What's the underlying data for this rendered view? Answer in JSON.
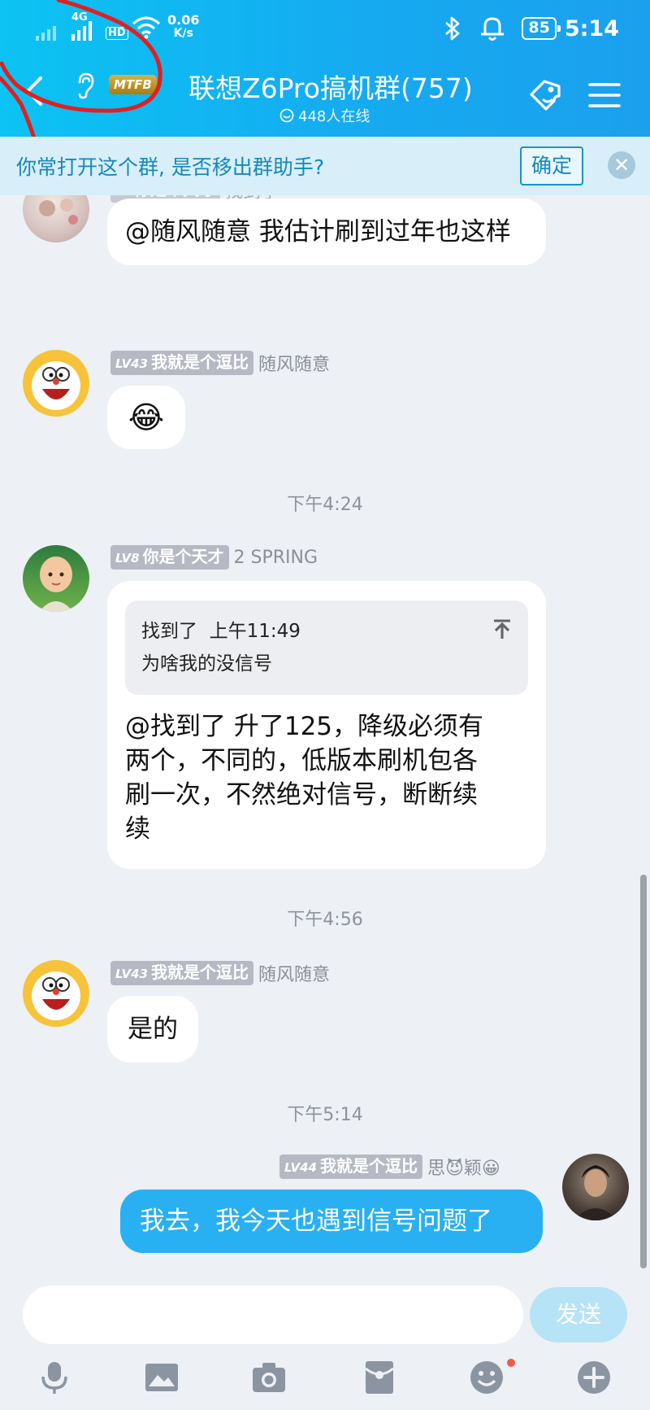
{
  "status_bar": {
    "net1": "4G",
    "net2": "HD",
    "speed_value": "0.06",
    "speed_unit": "K/s",
    "battery": "85",
    "time": "5:14"
  },
  "header": {
    "badge": "MTFB",
    "title": "联想Z6Pro搞机群(757)",
    "online": "448人在线"
  },
  "banner": {
    "text": "你常打开这个群, 是否移出群助手?",
    "confirm": "确定"
  },
  "messages": [
    {
      "text": "@随风随意 我估计刷到过年也这样"
    },
    {
      "level": "LV43",
      "title": "我就是个逗比",
      "name": "随风随意",
      "text": "😂"
    },
    {
      "time": "下午4:24"
    },
    {
      "level": "LV8",
      "title": "你是个天才",
      "name": "2 SPRING",
      "quote_author": "找到了",
      "quote_time": "上午11:49",
      "quote_text": "为啥我的没信号",
      "line1": "@找到了 升了125，降级必须有",
      "line2": "两个，不同的，低版本刷机包各",
      "line3": "刷一次，不然绝对信号，断断续",
      "line4": "续"
    },
    {
      "time": "下午4:56"
    },
    {
      "level": "LV43",
      "title": "我就是个逗比",
      "name": "随风随意",
      "text": "是的"
    },
    {
      "time": "下午5:14"
    },
    {
      "level": "LV44",
      "title": "我就是个逗比",
      "name": "思😈颖😀",
      "text": "我去，我今天也遇到信号问题了"
    }
  ],
  "input": {
    "send": "发送"
  },
  "toolbar": {
    "icons": [
      "mic-icon",
      "image-icon",
      "camera-icon",
      "red-packet-icon",
      "emoji-icon",
      "plus-icon"
    ]
  },
  "colors": {
    "header": "#16a9f0",
    "bubble_self": "#28b0f2",
    "background": "#edf0f5"
  }
}
